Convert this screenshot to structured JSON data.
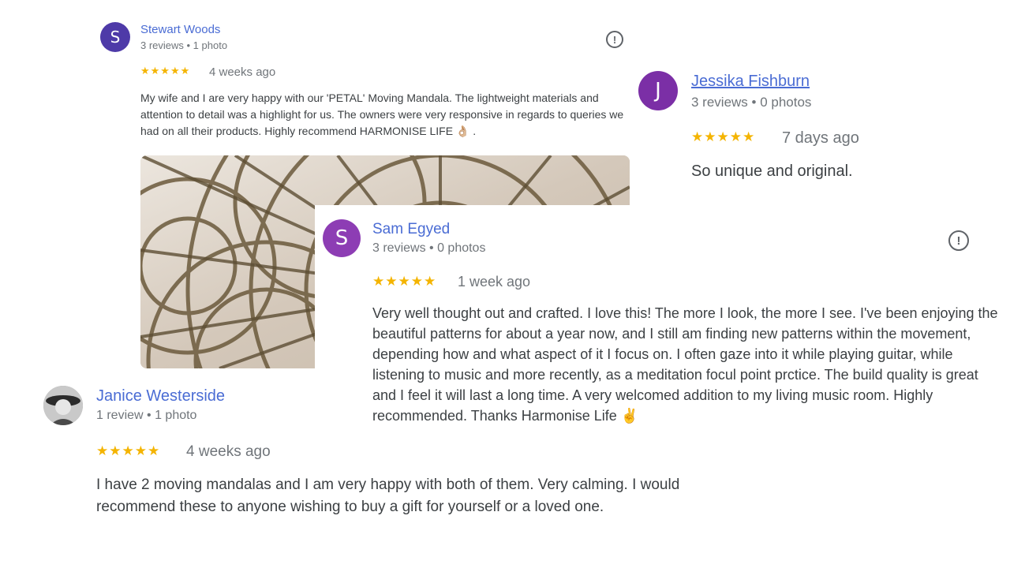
{
  "colors": {
    "name_link": "#4a6cd4",
    "star": "#f4b400",
    "meta": "#70757a",
    "body": "#3c4043"
  },
  "reviews": [
    {
      "name": "Stewart Woods",
      "avatar_letter": "S",
      "avatar_color": "#4e3aa8",
      "meta": "3 reviews • 1 photo",
      "stars": "★★★★★",
      "rating": 5,
      "date": "4 weeks ago",
      "text": "My wife and I are very happy with our 'PETAL' Moving Mandala. The lightweight materials and attention to detail was a highlight for us. The owners were very responsive in regards to queries we had on all their products. Highly recommend HARMONISE LIFE 👌🏼 .",
      "flag_icon": "report-icon",
      "photo": "mandala-photo"
    },
    {
      "name": "Jessika Fishburn",
      "avatar_letter": "J",
      "avatar_color": "#7b2fa6",
      "meta": "3 reviews • 0 photos",
      "stars": "★★★★★",
      "rating": 5,
      "date": "7 days ago",
      "text": "So unique and original."
    },
    {
      "name": "Sam Egyed",
      "avatar_letter": "S",
      "avatar_color": "#8d3db4",
      "meta": "3 reviews • 0 photos",
      "stars": "★★★★★",
      "rating": 5,
      "date": "1 week ago",
      "text": "Very well thought out and crafted. I love this! The more I look, the more I see. I've been enjoying the beautiful patterns for about a year now, and I still am finding new patterns within the movement, depending how and what aspect of it I focus on. I often gaze into it while playing guitar, while listening to music and more recently, as a meditation focul point prctice. The build quality is great and I feel it will last a long time. A very welcomed addition to my living music room. Highly recommended. Thanks Harmonise Life ✌️",
      "flag_icon": "report-icon"
    },
    {
      "name": "Janice Westerside",
      "avatar_icon": "user-photo-avatar",
      "meta": "1 review • 1 photo",
      "stars": "★★★★★",
      "rating": 5,
      "date": "4 weeks ago",
      "text": "I have 2 moving mandalas and I am very happy with both of them. Very calming. I would recommend these to anyone wishing to buy a gift for yourself or a loved one."
    }
  ]
}
